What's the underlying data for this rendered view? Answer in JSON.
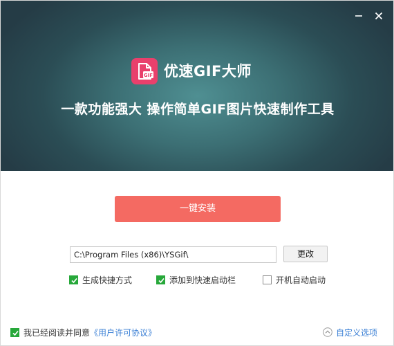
{
  "app": {
    "name": "优速GIF大师",
    "tagline": "一款功能强大 操作简单GIF图片快速制作工具",
    "logo_text": "GIF"
  },
  "window_controls": {
    "minimize_icon": "minimize-icon",
    "close_icon": "close-icon"
  },
  "install": {
    "button_label": "一键安装",
    "path_value": "C:\\Program Files (x86)\\YSGif\\",
    "change_label": "更改"
  },
  "options": [
    {
      "label": "生成快捷方式",
      "checked": true
    },
    {
      "label": "添加到快速启动栏",
      "checked": true
    },
    {
      "label": "开机自动启动",
      "checked": false
    }
  ],
  "footer": {
    "agree_prefix": "我已经阅读并同意",
    "agree_link": "《用户许可协议》",
    "agree_checked": true,
    "custom_options": "自定义选项"
  },
  "colors": {
    "banner_center": "#4f8f92",
    "banner_edge": "#253c46",
    "install_button": "#f46a62",
    "checkbox_checked": "#27a83a",
    "link": "#3a7fd5",
    "logo_bg": "#e9406c"
  }
}
